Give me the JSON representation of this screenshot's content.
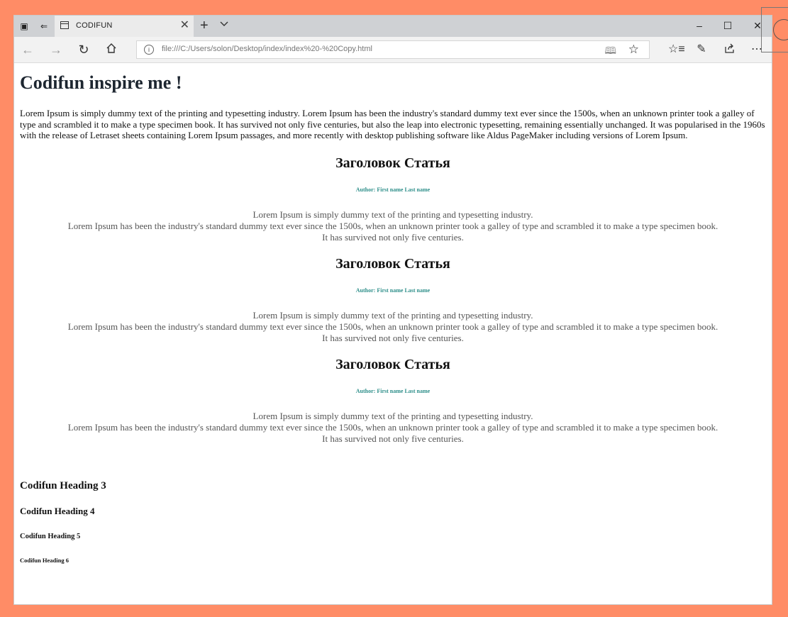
{
  "browser": {
    "tab_title": "CODIFUN",
    "url": "file:///C:/Users/solon/Desktop/index/index%20-%20Copy.html",
    "icons": {
      "tab_actions": "tabs-aside-icon",
      "set_aside": "set-tabs-aside-icon",
      "back": "back-arrow-icon",
      "forward": "forward-arrow-icon",
      "refresh": "refresh-icon",
      "home": "home-icon",
      "reading_view": "reading-view-icon",
      "favorite": "star-icon",
      "favorites_hub": "favorites-hub-icon",
      "notes": "pen-icon",
      "share": "share-icon",
      "more": "more-dots-icon"
    }
  },
  "page": {
    "title": "Codifun inspire me !",
    "intro": "Lorem Ipsum is simply dummy text of the printing and typesetting industry. Lorem Ipsum has been the industry's standard dummy text ever since the 1500s, when an unknown printer took a galley of type and scrambled it to make a type specimen book. It has survived not only five centuries, but also the leap into electronic typesetting, remaining essentially unchanged. It was popularised in the 1960s with the release of Letraset sheets containing Lorem Ipsum passages, and more recently with desktop publishing software like Aldus PageMaker including versions of Lorem Ipsum.",
    "articles": [
      {
        "heading": "Заголовок Статья",
        "author": "Author: First name Last name",
        "lines": [
          "Lorem Ipsum is simply dummy text of the printing and typesetting industry.",
          "Lorem Ipsum has been the industry's standard dummy text ever since the 1500s, when an unknown printer took a galley of type and scrambled it to make a type specimen book.",
          "It has survived not only five centuries."
        ]
      },
      {
        "heading": "Заголовок Статья",
        "author": "Author: First name Last name",
        "lines": [
          "Lorem Ipsum is simply dummy text of the printing and typesetting industry.",
          "Lorem Ipsum has been the industry's standard dummy text ever since the 1500s, when an unknown printer took a galley of type and scrambled it to make a type specimen book.",
          "It has survived not only five centuries."
        ]
      },
      {
        "heading": "Заголовок Статья",
        "author": "Author: First name Last name",
        "lines": [
          "Lorem Ipsum is simply dummy text of the printing and typesetting industry.",
          "Lorem Ipsum has been the industry's standard dummy text ever since the 1500s, when an unknown printer took a galley of type and scrambled it to make a type specimen book.",
          "It has survived not only five centuries."
        ]
      }
    ],
    "headings": {
      "h3": "Codifun Heading 3",
      "h4": "Codifun Heading 4",
      "h5": "Codifun Heading 5",
      "h6": "Codifun Heading 6"
    }
  },
  "colors": {
    "background_frame": "#FF8C66",
    "author_text": "#2e8f8a",
    "title_text": "#1d2630"
  }
}
